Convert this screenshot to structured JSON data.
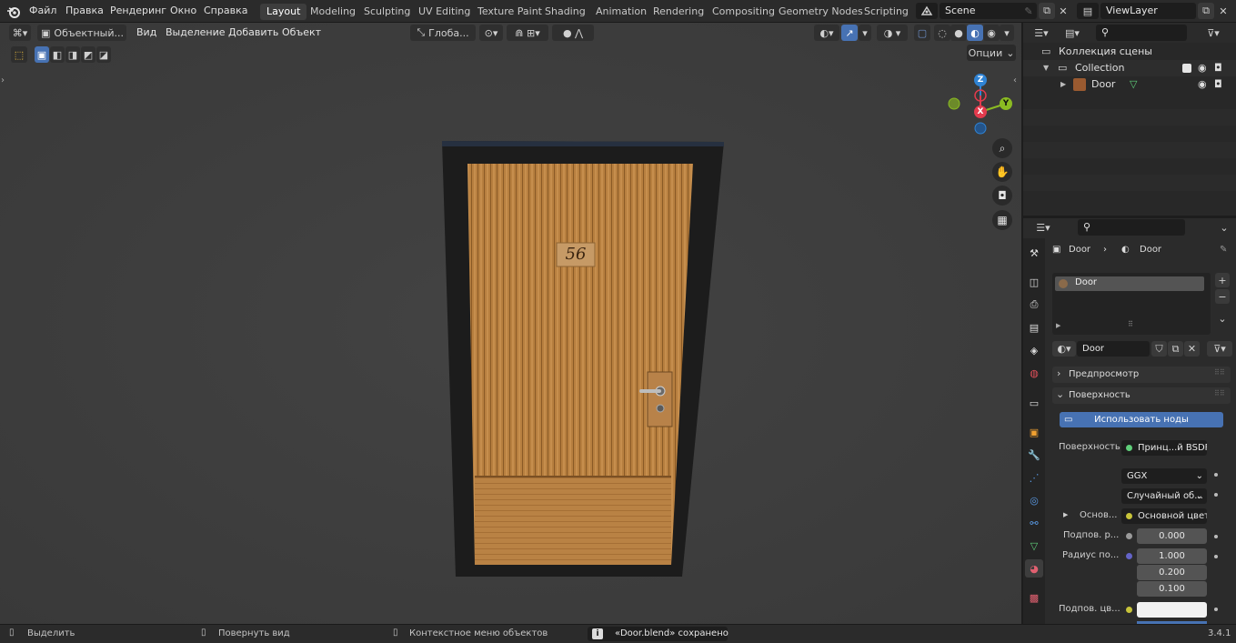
{
  "topbar": {
    "logo_icon": "blender-logo-icon",
    "menus": [
      "Файл",
      "Правка",
      "Рендеринг",
      "Окно",
      "Справка"
    ],
    "workspaces": [
      "Layout",
      "Modeling",
      "Sculpting",
      "UV Editing",
      "Texture Paint",
      "Shading",
      "Animation",
      "Rendering",
      "Compositing",
      "Geometry Nodes",
      "Scripting"
    ],
    "active_workspace": "Layout",
    "scene_name": "Scene",
    "view_layer": "ViewLayer"
  },
  "viewport": {
    "mode": "Объектный...",
    "menus": [
      "Вид",
      "Выделение",
      "Добавить",
      "Объект"
    ],
    "transform_orientation": "Глоба...",
    "options_label": "Опции",
    "gizmo_labels": {
      "z": "Z",
      "y": "Y",
      "x": "X"
    },
    "door_number": "56"
  },
  "outliner": {
    "root": "Коллекция сцены",
    "collection": "Collection",
    "object": "Door"
  },
  "properties": {
    "breadcrumb_object": "Door",
    "breadcrumb_material": "Door",
    "material_slot": "Door",
    "material_name": "Door",
    "panels": {
      "preview": "Предпросмотр",
      "surface": "Поверхность"
    },
    "use_nodes": "Использовать ноды",
    "surface_label": "Поверхность",
    "surface_value": "Принц...й BSDF",
    "distribution": "GGX",
    "subsurface_method": "Случайный об...",
    "base_label": "Основ...",
    "base_value": "Основной цвет",
    "subsurface_label": "Подпов. р...",
    "subsurface_value": "0.000",
    "radius_label": "Радиус по...",
    "radius_values": [
      "1.000",
      "0.200",
      "0.100"
    ],
    "subsurface_color_label": "Подпов. цв..."
  },
  "statusbar": {
    "select": "Выделить",
    "rotate": "Повернуть вид",
    "context": "Контекстное меню объектов",
    "message": "«Door.blend» сохранено",
    "version": "3.4.1"
  },
  "colors": {
    "accent": "#4772b3",
    "axis_x": "#e33a4d",
    "axis_y": "#8bbb22",
    "axis_z": "#2f83d4",
    "wood": "#b07a3a",
    "frame": "#1b1b1b"
  }
}
